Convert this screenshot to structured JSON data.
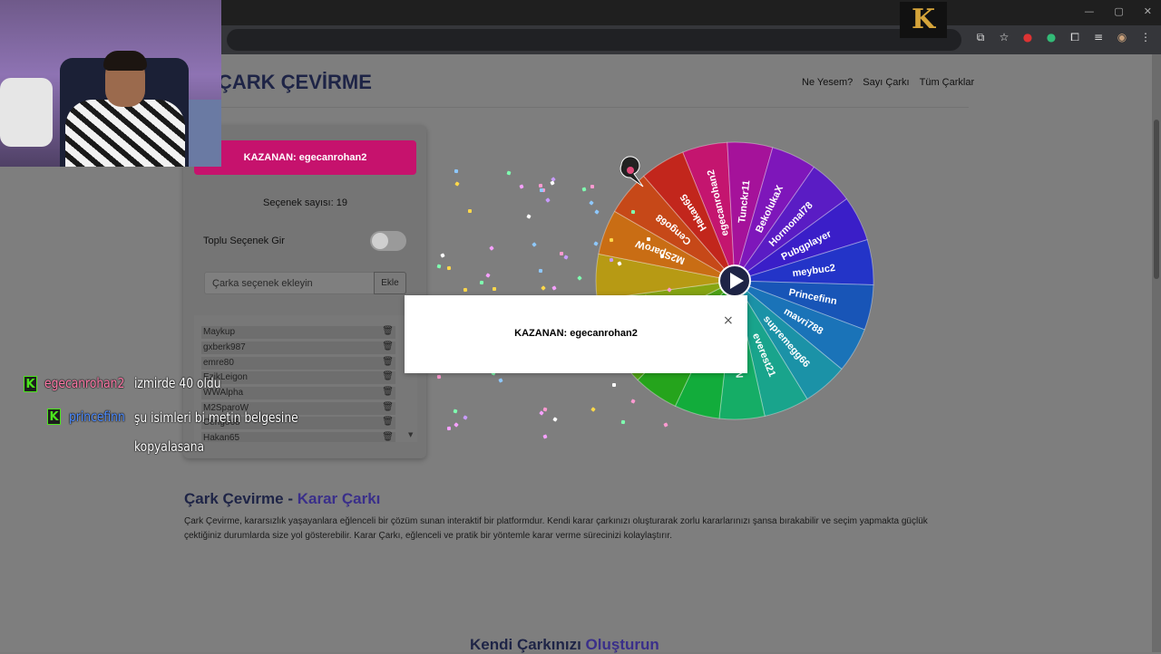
{
  "browser": {
    "window_controls": [
      "—",
      "▢",
      "✕"
    ],
    "toolbar_icons": [
      "⧉",
      "☆",
      "●",
      "●",
      "⧠",
      "≡",
      "◉",
      "⋮"
    ],
    "logo_letter": "K"
  },
  "site": {
    "title": "ÇARK ÇEVİRME",
    "nav": [
      "Ne Yesem?",
      "Sayı Çarkı",
      "Tüm Çarklar"
    ]
  },
  "panel": {
    "winner_banner": "KAZANAN: egecanrohan2",
    "option_count": "Seçenek sayısı: 19",
    "bulk_label": "Toplu Seçenek Gir",
    "bulk_toggle_on": false,
    "add_placeholder": "Çarka seçenek ekleyin",
    "add_button": "Ekle",
    "items": [
      "Maykup",
      "gxberk987",
      "emre80",
      "EzikLeigon",
      "WWAlpha",
      "M2SparoW",
      "Cengo68",
      "Hakan65"
    ]
  },
  "wheel": {
    "labels": [
      "egecanrohan2",
      "Tunckr11",
      "BekolukaX",
      "Hormonal78",
      "Pubgplayer",
      "meybuc2",
      "Princefinn",
      "mavri788",
      "supremegg66",
      "everest21",
      "UNREN",
      "",
      "",
      "",
      "",
      "",
      "M2SparoW",
      "Cengo68",
      "Hakan65"
    ],
    "colors": [
      "#c4156f",
      "#a5129a",
      "#7e16ba",
      "#5a1cc4",
      "#3a1ec8",
      "#2334c8",
      "#1855b7",
      "#1a73b8",
      "#1b92a7",
      "#19a48c",
      "#15ad66",
      "#12ac3b",
      "#25a41c",
      "#4ea314",
      "#86a512",
      "#b79a14",
      "#c96d14",
      "#c64818",
      "#c2261c"
    ]
  },
  "modal": {
    "text": "KAZANAN: egecanrohan2",
    "close": "×"
  },
  "chat": [
    {
      "user": "egecanrohan2",
      "message": "izmirde 40 oldu"
    },
    {
      "user": "princefinn",
      "message": "şu isimleri bi metin belgesine",
      "message2": "kopyalasana"
    }
  ],
  "content": {
    "section_title_a": "Çark Çevirme - ",
    "section_title_b": "Karar Çarkı",
    "paragraph": "Çark Çevirme, kararsızlık yaşayanlara eğlenceli bir çözüm sunan interaktif bir platformdur. Kendi karar çarkınızı oluşturarak zorlu kararlarınızı şansa bırakabilir ve seçim yapmakta güçlük çektiğiniz durumlarda size yol gösterebilir. Karar Çarkı, eğlenceli ve pratik bir yöntemle karar verme sürecinizi kolaylaştırır.",
    "section2_a": "Kendi Çarkınızı ",
    "section2_b": "Oluşturun"
  }
}
